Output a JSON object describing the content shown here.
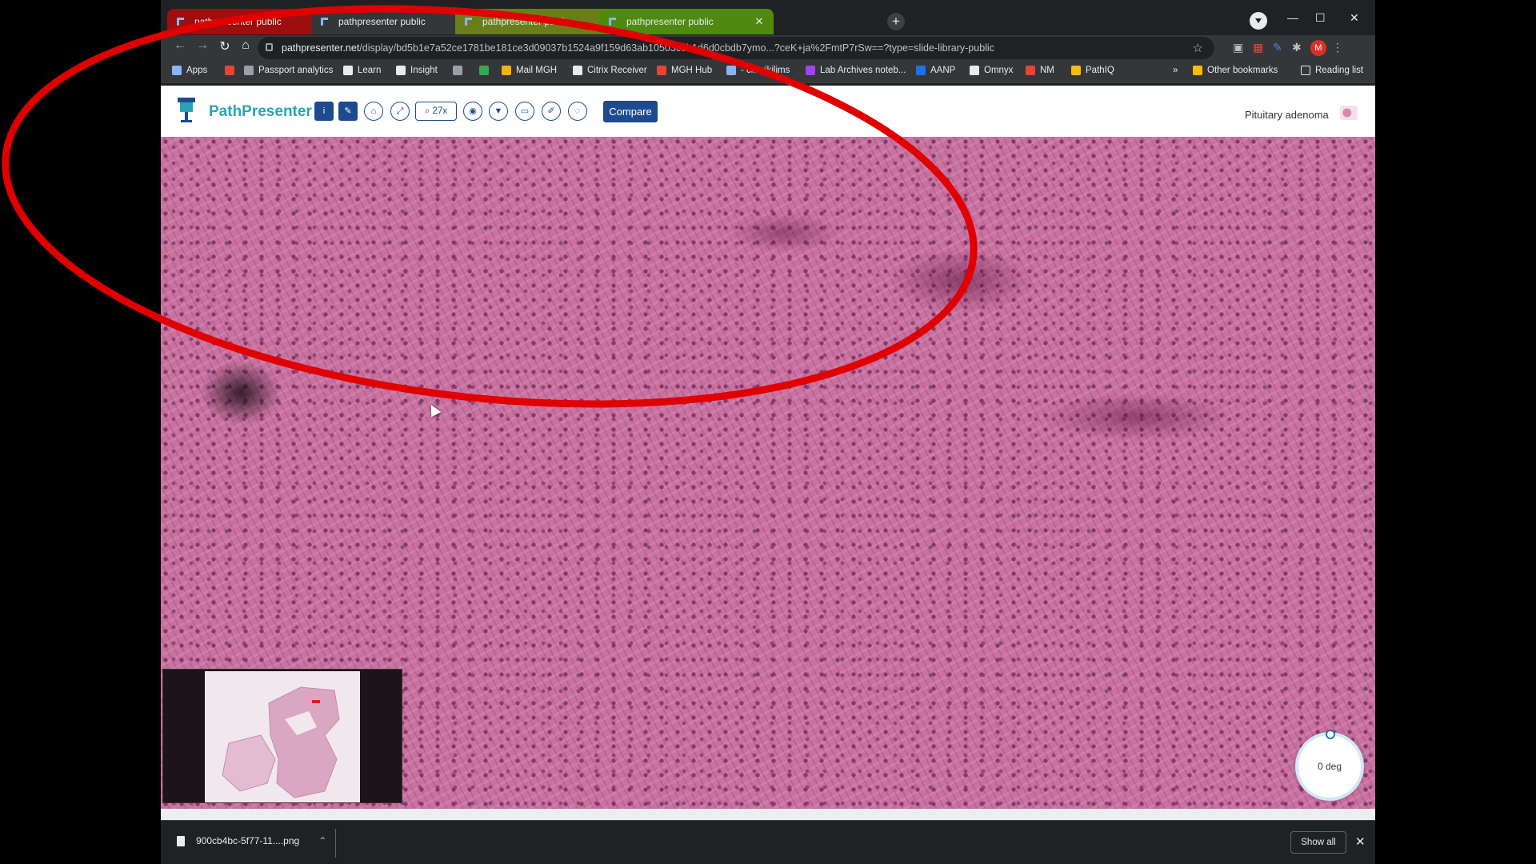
{
  "browser": {
    "tabs": [
      {
        "label": "pathpresenter public",
        "style": "red"
      },
      {
        "label": "pathpresenter public",
        "style": "active"
      },
      {
        "label": "pathpresenter public",
        "style": "green1"
      },
      {
        "label": "pathpresenter public",
        "style": "green2"
      }
    ],
    "new_tab": "+",
    "window_controls": {
      "minimize": "—",
      "maximize": "☐",
      "close": "✕"
    },
    "url_domain": "pathpresenter.net",
    "url_path": "/display/bd5b1e7a52ce1781be181ce3d09037b1524a9f159d63ab10503ceb1d6d0cbdb7ymo",
    "url_tail": "...?ceK+ja%2FmtP7rSw==?type=slide-library-public",
    "profile_initial": "M"
  },
  "bookmarks": [
    {
      "label": "Apps",
      "icon_color": "#8ab4f8"
    },
    {
      "label": "",
      "icon_color": "#ea4335"
    },
    {
      "label": "Passport analytics",
      "icon_color": "#9aa0a6"
    },
    {
      "label": "Learn",
      "icon_color": "#e8eaed"
    },
    {
      "label": "Insight",
      "icon_color": "#e8eaed"
    },
    {
      "label": "",
      "icon_color": "#9aa0a6"
    },
    {
      "label": "",
      "icon_color": "#34a853"
    },
    {
      "label": "Mail MGH",
      "icon_color": "#f4b400"
    },
    {
      "label": "Citrix Receiver",
      "icon_color": "#e8eaed"
    },
    {
      "label": "MGH Hub",
      "icon_color": "#ea4335"
    },
    {
      "label": "- cidwikilims",
      "icon_color": "#8ab4f8"
    },
    {
      "label": "Lab Archives noteb...",
      "icon_color": "#a142f4"
    },
    {
      "label": "AANP",
      "icon_color": "#1a73e8"
    },
    {
      "label": "Omnyx",
      "icon_color": "#e8eaed"
    },
    {
      "label": "NM",
      "icon_color": "#ea4335"
    },
    {
      "label": "PathIQ",
      "icon_color": "#fbbc04"
    }
  ],
  "bookmarks_overflow": "»",
  "other_bookmarks": "Other bookmarks",
  "reading_list": "Reading list",
  "app": {
    "brand": "PathPresenter",
    "zoom": "27x",
    "compare": "Compare",
    "slide_title": "Pituitary adenoma",
    "rotation": "0 deg",
    "toolbar_icons": [
      "info-icon",
      "ruler-icon",
      "home-icon",
      "fullscreen-icon",
      "zoom-icon",
      "camera-icon",
      "filter-icon",
      "present-icon",
      "pen-icon",
      "rotate-icon"
    ]
  },
  "downloads": {
    "file": "900cb4bc-5f77-11....png",
    "show_all": "Show all"
  },
  "colors": {
    "annotation": "#e00000",
    "brand": "#2aa3b8",
    "toolbar_blue": "#1e4b8f"
  }
}
